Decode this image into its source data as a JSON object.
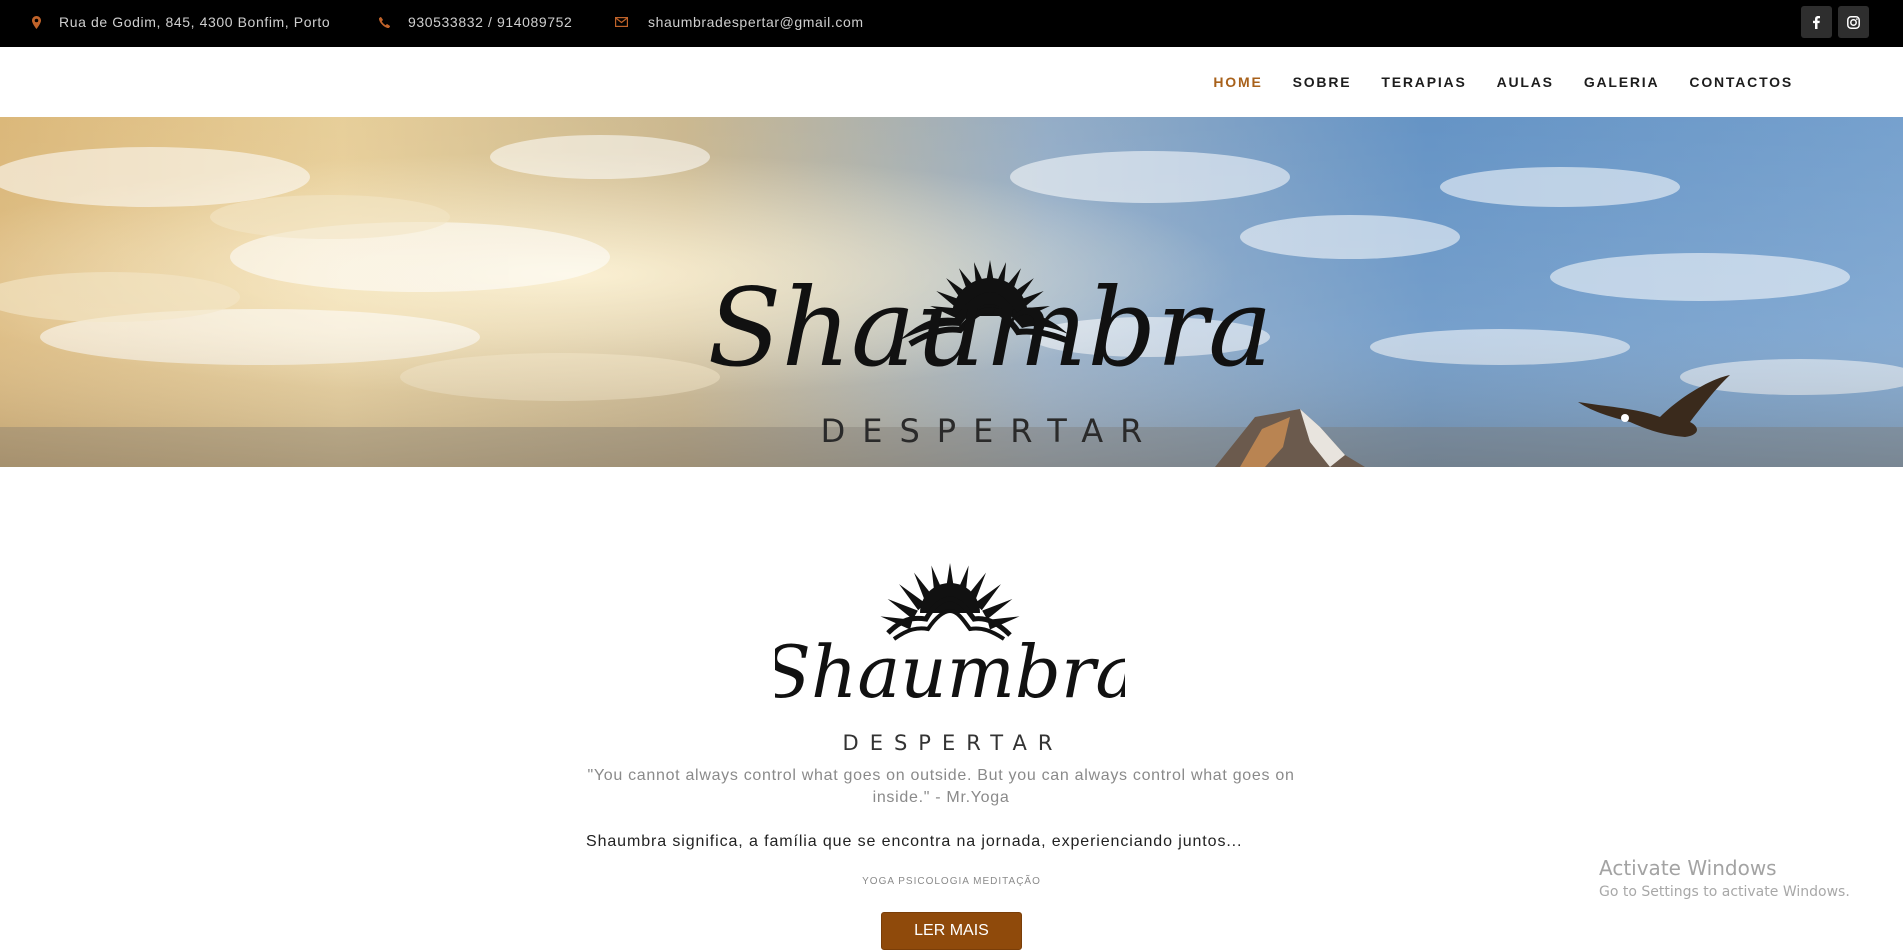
{
  "topbar": {
    "address": "Rua de Godim, 845, 4300 Bonfim, Porto",
    "phone": "930533832 / 914089752",
    "email": "shaumbradespertar@gmail.com",
    "address_icon": "map-marker-icon",
    "phone_icon": "phone-icon",
    "email_icon": "envelope-icon",
    "social": [
      "facebook-icon",
      "instagram-icon"
    ]
  },
  "nav": {
    "items": [
      {
        "label": "HOME",
        "active": true
      },
      {
        "label": "SOBRE",
        "active": false
      },
      {
        "label": "TERAPIAS",
        "active": false
      },
      {
        "label": "AULAS",
        "active": false
      },
      {
        "label": "GALERIA",
        "active": false
      },
      {
        "label": "CONTACTOS",
        "active": false
      }
    ]
  },
  "hero": {
    "logo_text": "Shaumbra",
    "logo_subtext": "DESPERTAR"
  },
  "main": {
    "logo_text": "Shaumbra",
    "logo_subtext": "DESPERTAR",
    "quote": "\"You cannot always control what goes on outside. But you can always control what goes on inside.\" - Mr.Yoga",
    "description": "Shaumbra significa, a família que se encontra na jornada, experienciando juntos...",
    "tags": "YOGA PSICOLOGIA MEDITAÇÃO",
    "button_label": "LER MAIS"
  },
  "watermark": {
    "title": "Activate Windows",
    "subtitle": "Go to Settings to activate Windows."
  },
  "colors": {
    "accent": "#a8611b",
    "button": "#8f4a0b",
    "icon": "#c0632a",
    "topbar": "#000000"
  }
}
